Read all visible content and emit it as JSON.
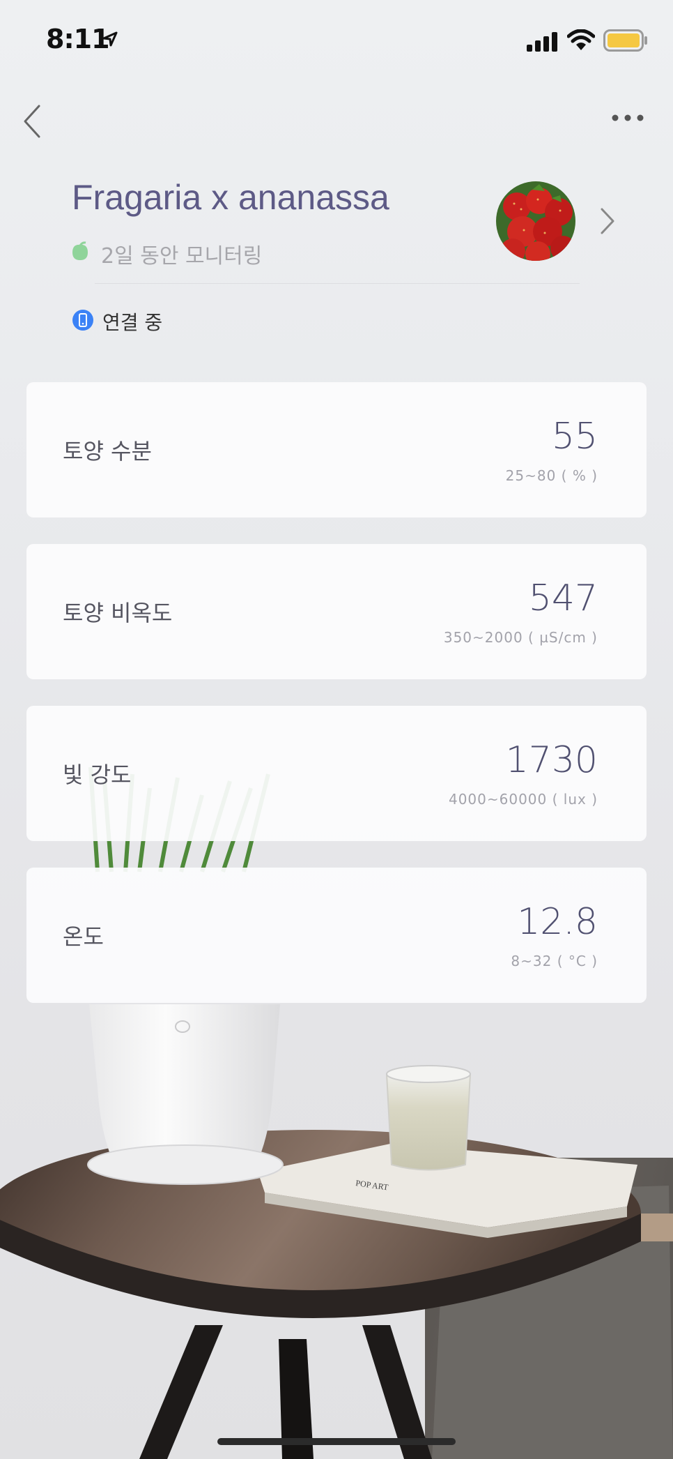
{
  "status": {
    "time": "8:11"
  },
  "header": {
    "plant_name": "Fragaria x ananassa",
    "monitoring": "2일 동안 모니터링",
    "connection": "연결 중"
  },
  "metrics": [
    {
      "label": "토양 수분",
      "value": "55",
      "range": "25~80 ( % )"
    },
    {
      "label": "토양 비옥도",
      "value": "547",
      "range": "350~2000 ( µS/cm )"
    },
    {
      "label": "빛 강도",
      "value": "1730",
      "range": "4000~60000 ( lux )"
    },
    {
      "label": "온도",
      "value": "12.8",
      "range": "8~32 ( °C )"
    }
  ],
  "colors": {
    "accent_title": "#5d5a86",
    "leaf_green": "#8fd49a",
    "connection_blue": "#3b82f6",
    "battery_yellow": "#f5c842"
  },
  "icons": [
    "location-arrow-icon",
    "signal-icon",
    "wifi-icon",
    "battery-icon",
    "back-chevron-icon",
    "more-dots-icon",
    "leaf-icon",
    "plant-avatar",
    "chevron-right-icon",
    "phone-icon"
  ]
}
